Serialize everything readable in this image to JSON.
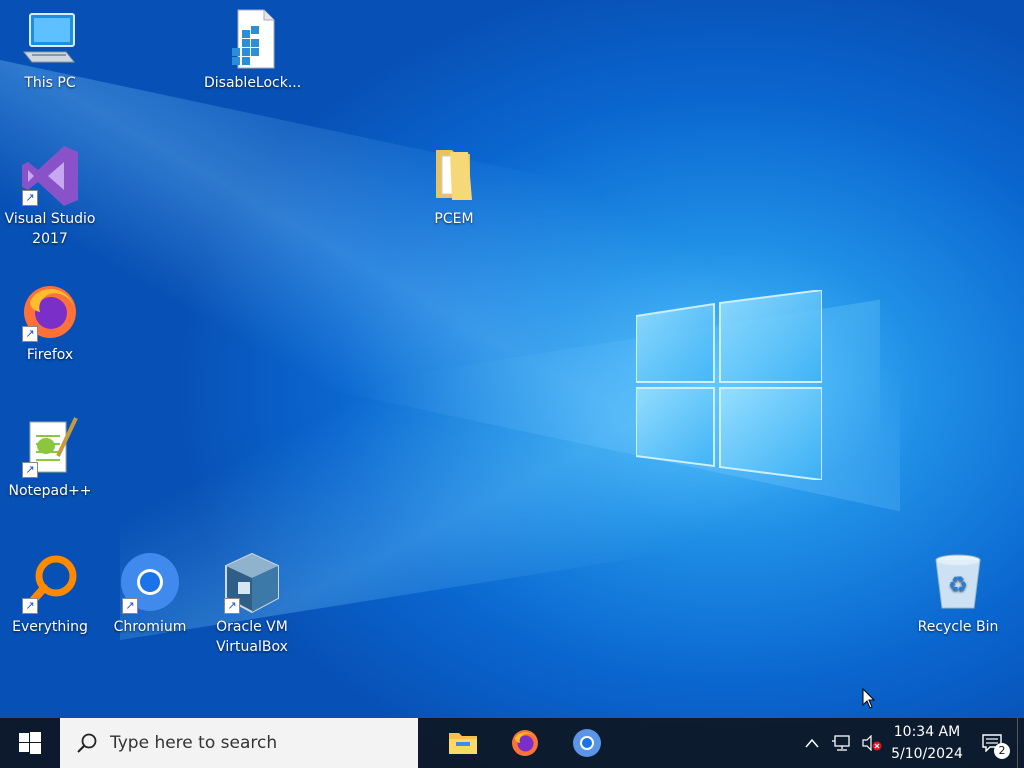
{
  "desktop": {
    "icons": [
      {
        "id": "this-pc",
        "label": "This PC",
        "shortcut": false
      },
      {
        "id": "disablelock",
        "label": "DisableLock...",
        "shortcut": false
      },
      {
        "id": "visual-studio",
        "label": "Visual Studio\n2017",
        "shortcut": true
      },
      {
        "id": "pcem",
        "label": "PCEM",
        "shortcut": false
      },
      {
        "id": "firefox",
        "label": "Firefox",
        "shortcut": true
      },
      {
        "id": "notepadpp",
        "label": "Notepad++",
        "shortcut": true
      },
      {
        "id": "everything",
        "label": "Everything",
        "shortcut": true
      },
      {
        "id": "chromium",
        "label": "Chromium",
        "shortcut": true
      },
      {
        "id": "virtualbox",
        "label": "Oracle VM\nVirtualBox",
        "shortcut": true
      },
      {
        "id": "recycle-bin",
        "label": "Recycle Bin",
        "shortcut": false
      }
    ]
  },
  "taskbar": {
    "search_placeholder": "Type here to search",
    "pinned_apps": [
      "File Explorer",
      "Firefox",
      "Chromium"
    ],
    "tray": {
      "time": "10:34 AM",
      "date": "5/10/2024",
      "notification_count": "2"
    }
  },
  "colors": {
    "accent": "#0a66cf",
    "taskbar": "#0e1724"
  }
}
